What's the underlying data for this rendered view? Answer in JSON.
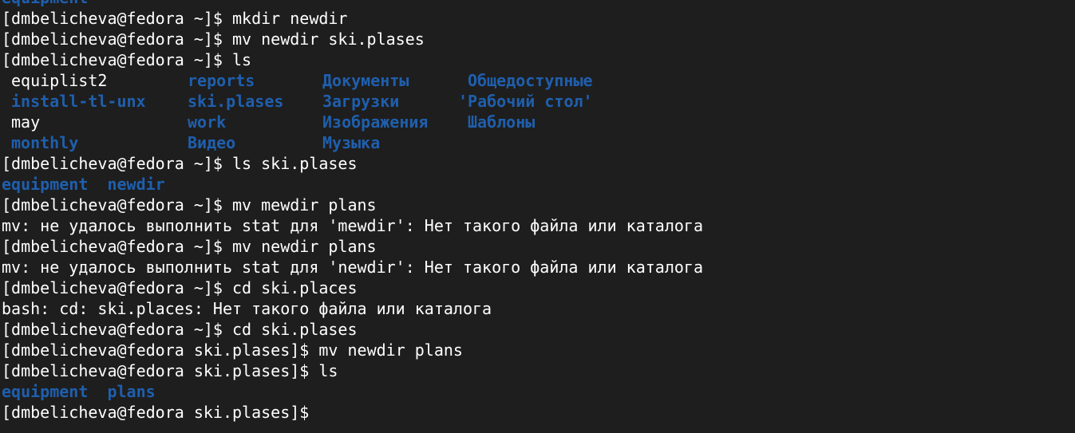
{
  "terminal": {
    "prompt_home": "[dmbelicheva@fedora ~]$ ",
    "prompt_ski": "[dmbelicheva@fedora ski.plases]$ ",
    "dir_color": "#1f5fad",
    "text_color": "#ffffff",
    "bg_color": "#1e1e1e",
    "lines": {
      "l0": "equipment",
      "l1_cmd": "mkdir newdir",
      "l2_cmd": "mv newdir ski.plases",
      "l3_cmd": "ls",
      "ls_rows": [
        [
          "equiplist2",
          "reports",
          "Документы",
          "Общедоступные"
        ],
        [
          "install-tl-unx",
          "ski.plases",
          "Загрузки",
          "'Рабочий стол'"
        ],
        [
          "may",
          "work",
          "Изображения",
          "Шаблоны"
        ],
        [
          "monthly",
          "Видео",
          "Музыка",
          ""
        ]
      ],
      "l8_cmd": "ls ski.plases",
      "l9_a": "equipment",
      "l9_b": "newdir",
      "l10_cmd": "mv mewdir plans",
      "l11_out": "mv: не удалось выполнить stat для 'mewdir': Нет такого файла или каталога",
      "l12_cmd": "mv newdir plans",
      "l13_out": "mv: не удалось выполнить stat для 'newdir': Нет такого файла или каталога",
      "l14_cmd": "cd ski.places",
      "l15_out": "bash: cd: ski.places: Нет такого файла или каталога",
      "l16_cmd": "cd ski.plases",
      "l17_cmd": "mv newdir plans",
      "l18_cmd": "ls",
      "l19_a": "equipment",
      "l19_b": "plans"
    }
  }
}
